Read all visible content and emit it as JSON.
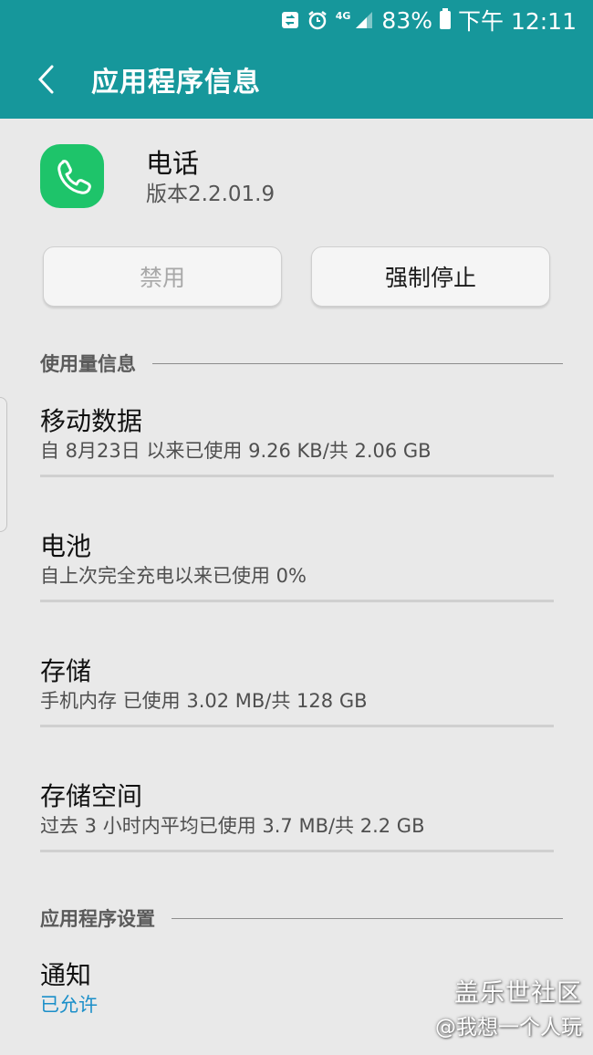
{
  "status_bar": {
    "network": "4G",
    "battery": "83%",
    "time": "下午 12:11"
  },
  "app_bar": {
    "title": "应用程序信息"
  },
  "app": {
    "name": "电话",
    "version": "版本2.2.01.9",
    "icon": "phone-icon",
    "icon_color": "#1ec46a"
  },
  "actions": {
    "disable_label": "禁用",
    "force_stop_label": "强制停止"
  },
  "usage_section": {
    "header": "使用量信息",
    "items": [
      {
        "title": "移动数据",
        "subtitle": "自 8月23日 以来已使用 9.26 KB/共 2.06 GB"
      },
      {
        "title": "电池",
        "subtitle": "自上次完全充电以来已使用 0%"
      },
      {
        "title": "存储",
        "subtitle": "手机内存 已使用 3.02 MB/共 128 GB"
      },
      {
        "title": "存储空间",
        "subtitle": "过去 3 小时内平均已使用 3.7 MB/共 2.2 GB"
      }
    ]
  },
  "settings_section": {
    "header": "应用程序设置",
    "items": [
      {
        "title": "通知",
        "subtitle": "已允许"
      }
    ]
  },
  "watermark": {
    "line1": "盖乐世社区",
    "line2": "@我想一个人玩"
  },
  "colors": {
    "accent": "#16979b",
    "link": "#1b8fc9"
  }
}
